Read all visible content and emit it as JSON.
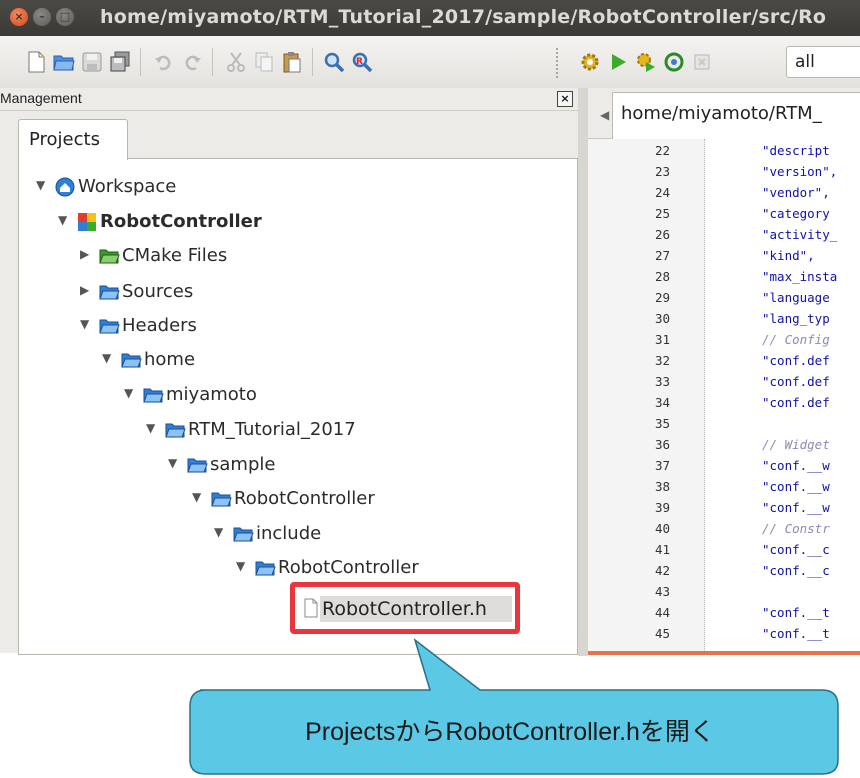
{
  "window": {
    "title": "home/miyamoto/RTM_Tutorial_2017/sample/RobotController/src/Ro"
  },
  "toolbar": {
    "target_value": "all"
  },
  "management": {
    "title": "Management",
    "tab_label": "Projects",
    "tree": [
      {
        "label": "Workspace",
        "icon": "workspace-icon",
        "expanded": true
      },
      {
        "label": "RobotController",
        "icon": "project-icon",
        "expanded": true,
        "bold": true
      },
      {
        "label": "CMake Files",
        "icon": "folder-icon",
        "expanded": false
      },
      {
        "label": "Sources",
        "icon": "folder-icon",
        "expanded": false
      },
      {
        "label": "Headers",
        "icon": "folder-icon",
        "expanded": true
      },
      {
        "label": "home",
        "icon": "folder-icon",
        "expanded": true
      },
      {
        "label": "miyamoto",
        "icon": "folder-icon",
        "expanded": true
      },
      {
        "label": "RTM_Tutorial_2017",
        "icon": "folder-icon",
        "expanded": true
      },
      {
        "label": "sample",
        "icon": "folder-icon",
        "expanded": true
      },
      {
        "label": "RobotController",
        "icon": "folder-icon",
        "expanded": true
      },
      {
        "label": "include",
        "icon": "folder-icon",
        "expanded": true
      },
      {
        "label": "RobotController",
        "icon": "folder-icon",
        "expanded": true
      }
    ],
    "selected_file": "RobotController.h"
  },
  "editor": {
    "tab_label": "home/miyamoto/RTM_",
    "lines": [
      {
        "n": "22",
        "code": "\"descript",
        "kind": "str"
      },
      {
        "n": "23",
        "code": "\"version\",",
        "kind": "str"
      },
      {
        "n": "24",
        "code": "\"vendor\",",
        "kind": "str"
      },
      {
        "n": "25",
        "code": "\"category",
        "kind": "str"
      },
      {
        "n": "26",
        "code": "\"activity_",
        "kind": "str"
      },
      {
        "n": "27",
        "code": "\"kind\",",
        "kind": "str"
      },
      {
        "n": "28",
        "code": "\"max_insta",
        "kind": "str"
      },
      {
        "n": "29",
        "code": "\"language",
        "kind": "str"
      },
      {
        "n": "30",
        "code": "\"lang_typ",
        "kind": "str"
      },
      {
        "n": "31",
        "code": "// Config",
        "kind": "cmt"
      },
      {
        "n": "32",
        "code": "\"conf.def",
        "kind": "str"
      },
      {
        "n": "33",
        "code": "\"conf.def",
        "kind": "str"
      },
      {
        "n": "34",
        "code": "\"conf.def",
        "kind": "str"
      },
      {
        "n": "35",
        "code": "",
        "kind": "str"
      },
      {
        "n": "36",
        "code": "// Widget",
        "kind": "cmt"
      },
      {
        "n": "37",
        "code": "\"conf.__w",
        "kind": "str"
      },
      {
        "n": "38",
        "code": "\"conf.__w",
        "kind": "str"
      },
      {
        "n": "39",
        "code": "\"conf.__w",
        "kind": "str"
      },
      {
        "n": "40",
        "code": "// Constr",
        "kind": "cmt"
      },
      {
        "n": "41",
        "code": "\"conf.__c",
        "kind": "str"
      },
      {
        "n": "42",
        "code": "\"conf.__c",
        "kind": "str"
      },
      {
        "n": "43",
        "code": "",
        "kind": "str"
      },
      {
        "n": "44",
        "code": "\"conf.__t",
        "kind": "str"
      },
      {
        "n": "45",
        "code": "\"conf.__t",
        "kind": "str"
      }
    ]
  },
  "callout": {
    "text": "ProjectsからRobotController.hを開く",
    "fill": "#5bc8e6",
    "border": "#2a6f86"
  },
  "colors": {
    "highlight": "#e8363c",
    "folder": "#2f7fd8",
    "cmake_folder": "#3a9a2a"
  }
}
